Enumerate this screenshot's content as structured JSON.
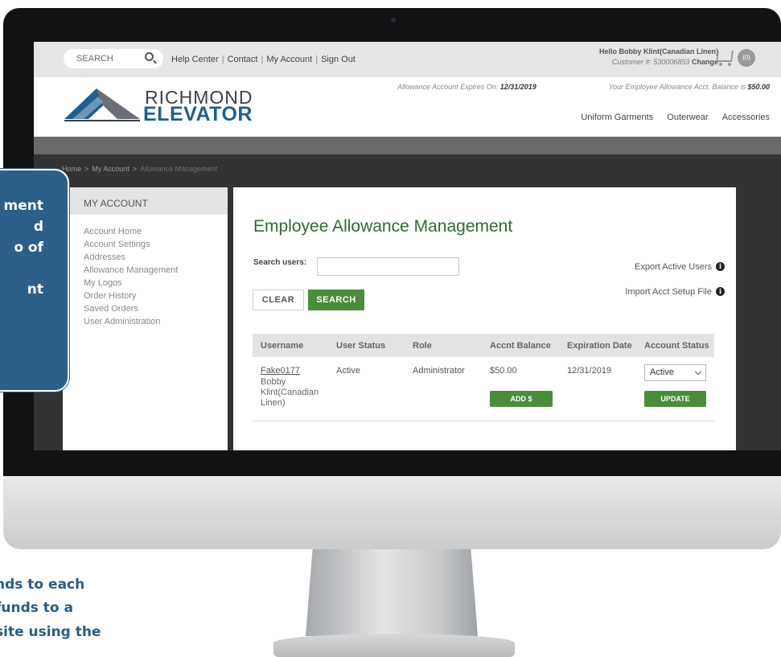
{
  "topbar": {
    "search_placeholder": "SEARCH",
    "links": [
      "Help Center",
      "Contact",
      "My Account",
      "Sign Out"
    ],
    "greeting": "Hello Bobby Klint(Canadian Linen)",
    "customer_label": "Customer #: 530006859",
    "change_label": "Change",
    "cart_count": "(0)"
  },
  "header": {
    "logo_line1": "RICHMOND",
    "logo_line2": "ELEVATOR",
    "expires_label": "Allowance Account Expires On:",
    "expires_date": "12/31/2019",
    "balance_label": "Your Employee Allowance Acct. Balance is",
    "balance_value": "$50.00",
    "nav": [
      "Uniform Garments",
      "Outerwear",
      "Accessories"
    ]
  },
  "breadcrumb": [
    "Home",
    "My Account",
    "Allowance Management"
  ],
  "sidebar": {
    "title": "MY ACCOUNT",
    "items": [
      "Account Home",
      "Account Settings",
      "Addresses",
      "Allowance Management",
      "My Logos",
      "Order History",
      "Saved Orders",
      "User Administration"
    ]
  },
  "main": {
    "title": "Employee Allowance Management",
    "search_label": "Search users:",
    "search_value": "",
    "export_label": "Export Active Users",
    "import_label": "Import Acct Setup File",
    "clear_label": "CLEAR",
    "search_button": "SEARCH",
    "table": {
      "headers": [
        "Username",
        "User Status",
        "Role",
        "Accnt Balance",
        "Expiration Date",
        "Account Status"
      ],
      "rows": [
        {
          "username": "Fake0177",
          "name": "Bobby Klint(Canadian Linen)",
          "status": "Active",
          "role": "Administrator",
          "balance": "$50.00",
          "expiration": "12/31/2019",
          "account_status": "Active",
          "add_label": "ADD $",
          "update_label": "UPDATE"
        }
      ]
    }
  },
  "overlay": {
    "callout_lines": [
      "ment",
      "d",
      "o of",
      "",
      "nt"
    ],
    "bottom_lines": [
      "nds to each",
      " funds to a",
      "site using the"
    ]
  },
  "colors": {
    "brand_green": "#4a8c3c",
    "title_green": "#2e6b32",
    "brand_blue": "#1e5f8e",
    "callout_blue": "#2c5f8a"
  }
}
